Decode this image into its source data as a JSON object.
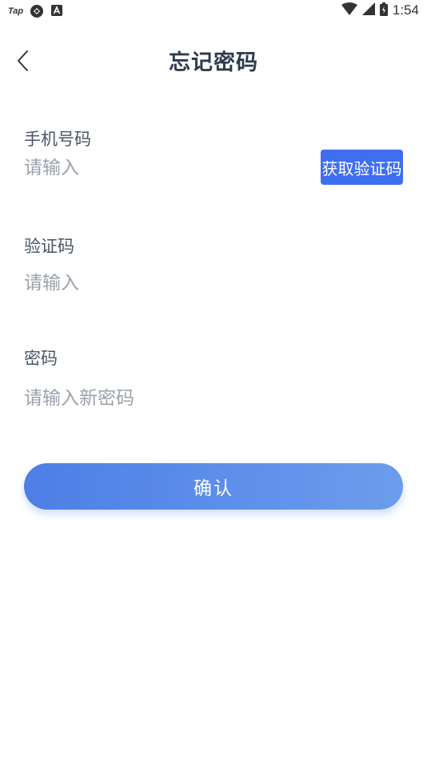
{
  "status_bar": {
    "app_logo": "Tap",
    "time": "1:54",
    "icons": [
      "taptap-logo",
      "vpn-icon",
      "a-notification-icon",
      "wifi-icon",
      "signal-icon",
      "battery-icon"
    ]
  },
  "header": {
    "title": "忘记密码",
    "back_icon": "chevron-left-icon"
  },
  "form": {
    "phone": {
      "label": "手机号码",
      "placeholder": "请输入",
      "value": ""
    },
    "get_code_label": "获取验证码",
    "code": {
      "label": "验证码",
      "placeholder": "请输入",
      "value": ""
    },
    "password": {
      "label": "密码",
      "placeholder": "请输入新密码",
      "value": ""
    },
    "confirm_label": "确认"
  },
  "colors": {
    "primary": "#3f6ef0",
    "confirm_gradient_start": "#4d7ee6",
    "confirm_gradient_end": "#6b9ded",
    "title": "#2f3c4e",
    "label": "#4a5566",
    "placeholder": "#9aa1ab"
  }
}
